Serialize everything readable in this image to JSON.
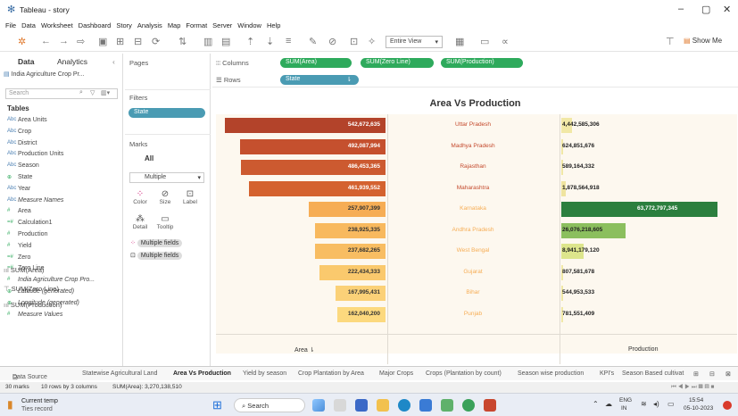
{
  "window": {
    "title": "Tableau - story",
    "minimize": "–",
    "maximize": "▢",
    "close": "✕"
  },
  "menu": [
    "File",
    "Data",
    "Worksheet",
    "Dashboard",
    "Story",
    "Analysis",
    "Map",
    "Format",
    "Server",
    "Window",
    "Help"
  ],
  "toolbar": {
    "view_mode": "Entire View",
    "show_me": "Show Me"
  },
  "data_pane": {
    "tab_data": "Data",
    "tab_analytics": "Analytics",
    "datasource": "India Agriculture Crop Pr...",
    "search_placeholder": "Search",
    "tables_heading": "Tables",
    "fields": [
      {
        "type": "Abc",
        "name": "Area Units",
        "italic": false
      },
      {
        "type": "Abc",
        "name": "Crop",
        "italic": false
      },
      {
        "type": "Abc",
        "name": "District",
        "italic": false
      },
      {
        "type": "Abc",
        "name": "Production Units",
        "italic": false
      },
      {
        "type": "Abc",
        "name": "Season",
        "italic": false
      },
      {
        "type": "⊕",
        "name": "State",
        "italic": false
      },
      {
        "type": "Abc",
        "name": "Year",
        "italic": false
      },
      {
        "type": "Abc",
        "name": "Measure Names",
        "italic": true
      },
      {
        "type": "#",
        "name": "Area",
        "italic": false
      },
      {
        "type": "=#",
        "name": "Calculation1",
        "italic": false
      },
      {
        "type": "#",
        "name": "Production",
        "italic": false
      },
      {
        "type": "#",
        "name": "Yield",
        "italic": false
      },
      {
        "type": "=#",
        "name": "Zero",
        "italic": false
      },
      {
        "type": "=#",
        "name": "Zero Line",
        "italic": false
      },
      {
        "type": "#",
        "name": "India Agriculture Crop Pro...",
        "italic": true
      },
      {
        "type": "⊕",
        "name": "Latitude (generated)",
        "italic": true
      },
      {
        "type": "⊕",
        "name": "Longitude (generated)",
        "italic": true
      },
      {
        "type": "#",
        "name": "Measure Values",
        "italic": true
      }
    ]
  },
  "pages": {
    "label": "Pages"
  },
  "filters": {
    "label": "Filters",
    "pill": "State"
  },
  "marks": {
    "label": "Marks",
    "all": "All",
    "type": "Multiple",
    "buttons": [
      "Color",
      "Size",
      "Label",
      "Detail",
      "Tooltip"
    ],
    "multi1": "Multiple fields",
    "multi2": "Multiple fields",
    "rows": [
      "SUM(Area)",
      "SUM(Zero Line)",
      "SUM(Production)"
    ]
  },
  "shelves": {
    "columns_label": "Columns",
    "rows_label": "Rows",
    "columns": [
      "SUM(Area)",
      "SUM(Zero Line)",
      "SUM(Production)"
    ],
    "rows": [
      "State"
    ]
  },
  "chart_data": {
    "type": "bar",
    "title": "Area Vs Production",
    "categories": [
      "Uttar Pradesh",
      "Madhya Pradesh",
      "Rajasthan",
      "Maharashtra",
      "Karnataka",
      "Andhra Pradesh",
      "West Bengal",
      "Gujarat",
      "Bihar",
      "Punjab"
    ],
    "series": [
      {
        "name": "Area",
        "values": [
          542672635,
          492087994,
          486453365,
          461939552,
          257907399,
          238925335,
          237682265,
          222434333,
          167995431,
          162040200
        ],
        "labels": [
          "542,672,635",
          "492,087,994",
          "486,453,365",
          "461,939,552",
          "257,907,399",
          "238,925,335",
          "237,682,265",
          "222,434,333",
          "167,995,431",
          "162,040,200"
        ]
      },
      {
        "name": "Production",
        "values": [
          4442585306,
          624851676,
          589164332,
          1878564918,
          63772797345,
          26076218605,
          8941179120,
          807581678,
          544953533,
          781551409
        ],
        "labels": [
          "4,442,585,306",
          "624,851,676",
          "589,164,332",
          "1,878,564,918",
          "63,772,797,345",
          "26,076,218,605",
          "8,941,179,120",
          "807,581,678",
          "544,953,533",
          "781,551,409"
        ]
      }
    ],
    "area_colors": [
      "#b3432a",
      "#c5502e",
      "#cc5a30",
      "#d4622f",
      "#f6ad55",
      "#f8b95e",
      "#f8bd62",
      "#fac96d",
      "#fbd178",
      "#fcd97e"
    ],
    "production_colors": [
      "#f1e8a6",
      "#f1e8a6",
      "#f1e8a6",
      "#efe49f",
      "#2b7f3e",
      "#8bbf5e",
      "#dde58c",
      "#f1e8a6",
      "#f1e8a6",
      "#f1e8a6"
    ],
    "state_label_colors": [
      "#c4492c",
      "#c4492c",
      "#c4492c",
      "#c4492c",
      "#f6ad55",
      "#f6ad55",
      "#f6ad55",
      "#f6ad55",
      "#f6ad55",
      "#f6ad55"
    ],
    "xlabel_area": "Area",
    "xlabel_production": "Production"
  },
  "sheet_tabs": [
    "Data Source",
    "Statewise Agricultural Land",
    "Area Vs Production",
    "Yield by season",
    "Crop Plantation by Area",
    "Major Crops",
    "Crops (Plantation by count)",
    "Season wise production",
    "KPI's",
    "Season Based cultivat"
  ],
  "status": {
    "marks": "30 marks",
    "rows": "10 rows by 3 columns",
    "sum": "SUM(Area): 3,270,138,510"
  },
  "taskbar": {
    "weather": "Current temp",
    "weather_sub": "Ties record",
    "search": "Search",
    "lang": "ENG",
    "lang_sub": "IN",
    "time": "15:54",
    "date": "05-10-2023"
  }
}
